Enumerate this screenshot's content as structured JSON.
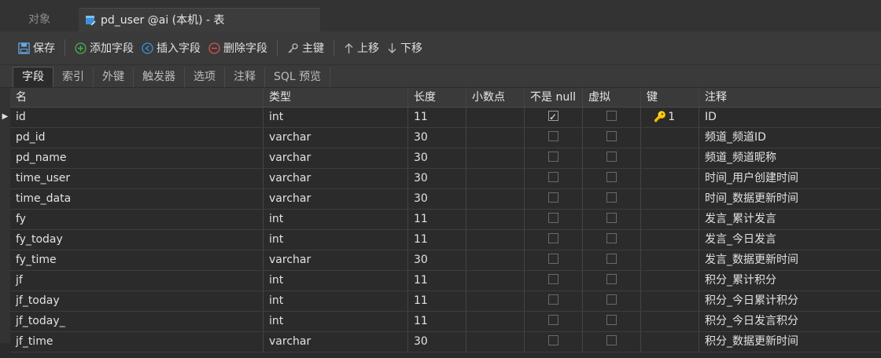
{
  "window_tabs": {
    "objects": "对象",
    "active": "pd_user @ai (本机) - 表"
  },
  "toolbar": {
    "save": "保存",
    "add_field": "添加字段",
    "insert_field": "插入字段",
    "delete_field": "删除字段",
    "primary_key": "主键",
    "move_up": "上移",
    "move_down": "下移"
  },
  "subtabs": [
    "字段",
    "索引",
    "外键",
    "触发器",
    "选项",
    "注释",
    "SQL 预览"
  ],
  "columns": [
    "名",
    "类型",
    "长度",
    "小数点",
    "不是 null",
    "虚拟",
    "键",
    "注释"
  ],
  "rows": [
    {
      "name": "id",
      "type": "int",
      "length": "11",
      "decimal": "",
      "not_null": true,
      "virtual": false,
      "key": "1",
      "comment": "ID"
    },
    {
      "name": "pd_id",
      "type": "varchar",
      "length": "30",
      "decimal": "",
      "not_null": false,
      "virtual": false,
      "key": "",
      "comment": "频道_频道ID"
    },
    {
      "name": "pd_name",
      "type": "varchar",
      "length": "30",
      "decimal": "",
      "not_null": false,
      "virtual": false,
      "key": "",
      "comment": "频道_频道昵称"
    },
    {
      "name": "time_user",
      "type": "varchar",
      "length": "30",
      "decimal": "",
      "not_null": false,
      "virtual": false,
      "key": "",
      "comment": "时间_用户创建时间"
    },
    {
      "name": "time_data",
      "type": "varchar",
      "length": "30",
      "decimal": "",
      "not_null": false,
      "virtual": false,
      "key": "",
      "comment": "时间_数据更新时间"
    },
    {
      "name": "fy",
      "type": "int",
      "length": "11",
      "decimal": "",
      "not_null": false,
      "virtual": false,
      "key": "",
      "comment": "发言_累计发言"
    },
    {
      "name": "fy_today",
      "type": "int",
      "length": "11",
      "decimal": "",
      "not_null": false,
      "virtual": false,
      "key": "",
      "comment": "发言_今日发言"
    },
    {
      "name": "fy_time",
      "type": "varchar",
      "length": "30",
      "decimal": "",
      "not_null": false,
      "virtual": false,
      "key": "",
      "comment": "发言_数据更新时间"
    },
    {
      "name": "jf",
      "type": "int",
      "length": "11",
      "decimal": "",
      "not_null": false,
      "virtual": false,
      "key": "",
      "comment": "积分_累计积分"
    },
    {
      "name": "jf_today",
      "type": "int",
      "length": "11",
      "decimal": "",
      "not_null": false,
      "virtual": false,
      "key": "",
      "comment": "积分_今日累计积分"
    },
    {
      "name": "jf_today_",
      "type": "int",
      "length": "11",
      "decimal": "",
      "not_null": false,
      "virtual": false,
      "key": "",
      "comment": "积分_今日发言积分"
    },
    {
      "name": "jf_time",
      "type": "varchar",
      "length": "30",
      "decimal": "",
      "not_null": false,
      "virtual": false,
      "key": "",
      "comment": "积分_数据更新时间"
    }
  ],
  "colors": {
    "background": "#2b2b2b",
    "toolbar": "#3a3a3a",
    "add_icon": "#4caf50",
    "insert_icon": "#3d8fd9",
    "delete_icon": "#d9534f",
    "key_icon": "#e8b93a"
  }
}
